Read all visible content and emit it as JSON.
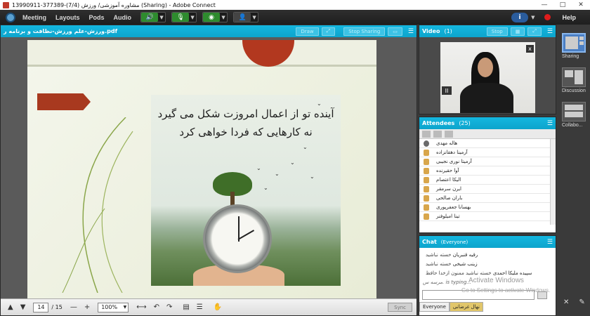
{
  "window": {
    "title": "13990911-377389-(7/4) مشاوره آموزشی/ ورزش (Sharing) - Adobe Connect",
    "buttons": [
      "—",
      "□",
      "✕"
    ]
  },
  "menubar": {
    "items": [
      "Meeting",
      "Layouts",
      "Pods",
      "Audio"
    ],
    "help": "Help",
    "info_icon": "i"
  },
  "share_pod": {
    "title": "ورزش-علم ورزش-نظافت و برنامه ر.pdf",
    "draw_label": "Draw",
    "stop_sharing_label": "Stop Sharing",
    "menu_glyph": "☰"
  },
  "slide": {
    "quote_line1": "آینده تو از اعمال امروزت شکل می گیرد",
    "quote_line2": "نه کارهایی که فردا خواهی کرد"
  },
  "pager": {
    "current_page": "14",
    "total_pages": "/ 15",
    "zoom": "100%",
    "sync_label": "Sync"
  },
  "video_pod": {
    "title": "Video",
    "count": "(1)",
    "stop_label": "Stop",
    "close_glyph": "x",
    "pause_glyph": "II"
  },
  "attendees_pod": {
    "title": "Attendees",
    "count": "(25)",
    "host": "هاله مهدی",
    "list": [
      "آرمینا دهقانزاده",
      "آرمیتا نوری نجیبی",
      "آوا حقیرنده",
      "الیکا اعتصام",
      "ایرن سرمقر",
      "باران صالحی",
      "بهسانا جعفرپوری",
      "تینا امیلوفنر"
    ]
  },
  "chat_pod": {
    "title": "Chat",
    "scope": "(Everyone)",
    "messages": [
      {
        "who": "رقیه قنبریان",
        "text": "خسته نباشید"
      },
      {
        "who": "زینب شیخی",
        "text": "خسته نباشید"
      },
      {
        "who": "سپیده ملیکا احمدی",
        "text": "خسته نباشید ممنون ازخدا حافظ"
      }
    ],
    "typing": "مرسه س. is typing...",
    "watermark1": "Activate Windows",
    "watermark2": "Go to Settings to activate Windows.",
    "tab_everyone": "Everyone",
    "tab_private": "نهال غرضانی"
  },
  "layouts": {
    "items": [
      "Sharing",
      "Discussion",
      "Collabo..."
    ]
  },
  "colors": {
    "pod_header": "#14b7e0",
    "slide_accent": "#a8391f",
    "menubar_bg": "#1e1e1e"
  }
}
